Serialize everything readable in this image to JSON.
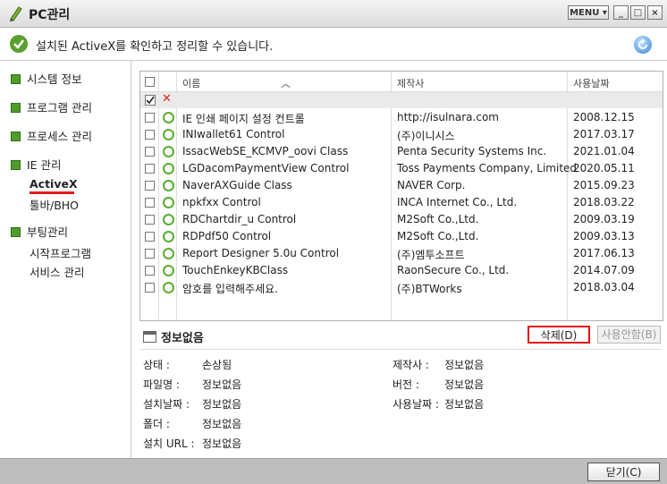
{
  "window": {
    "title": "PC관리",
    "menu_label": "MENU",
    "minimize": "_",
    "maximize": "□",
    "close": "×"
  },
  "info_message": "설치된 ActiveX를 확인하고 정리할 수 있습니다.",
  "sidebar": {
    "system_info": "시스템 정보",
    "program_mgmt": "프로그램 관리",
    "process_mgmt": "프로세스 관리",
    "ie_mgmt": "IE 관리",
    "activex": "ActiveX",
    "toolbar_bho": "툴바/BHO",
    "boot_mgmt": "부팅관리",
    "startup_programs": "시작프로그램",
    "service_mgmt": "서비스 관리"
  },
  "table": {
    "columns": [
      "이름",
      "제작사",
      "사용날짜"
    ],
    "rows": [
      [
        "IE 인쇄 페이지 설정 컨트롤",
        "http://isulnara.com",
        "2008.12.15"
      ],
      [
        "INIwallet61 Control",
        "(주)이니시스",
        "2017.03.17"
      ],
      [
        "IssacWebSE_KCMVP_oovi Class",
        "Penta Security Systems Inc.",
        "2021.01.04"
      ],
      [
        "LGDacomPaymentView Control",
        "Toss Payments Company, Limited",
        "2020.05.11"
      ],
      [
        "NaverAXGuide Class",
        "NAVER Corp.",
        "2015.09.23"
      ],
      [
        "npkfxx Control",
        "INCA Internet Co., Ltd.",
        "2018.03.22"
      ],
      [
        "RDChartdir_u Control",
        "M2Soft Co.,Ltd.",
        "2009.03.19"
      ],
      [
        "RDPdf50 Control",
        "M2Soft Co.,Ltd.",
        "2009.03.13"
      ],
      [
        "Report Designer 5.0u Control",
        "(주)엠투소프트",
        "2017.06.13"
      ],
      [
        "TouchEnkeyKBClass",
        "RaonSecure Co., Ltd.",
        "2014.07.09"
      ],
      [
        "암호를 입력해주세요.",
        "(주)BTWorks",
        "2018.03.04"
      ]
    ]
  },
  "detail": {
    "title": "정보없음",
    "delete_button": "삭제(D)",
    "disable_button": "사용안함(B)",
    "status_label": "상태 :",
    "status_value": "손상됨",
    "maker_label": "제작사 :",
    "maker_value": "정보없음",
    "filename_label": "파일명 :",
    "filename_value": "정보없음",
    "version_label": "버전 :",
    "version_value": "정보없음",
    "install_date_label": "설치날짜 :",
    "install_date_value": "정보없음",
    "use_date_label": "사용날짜 :",
    "use_date_value": "정보없음",
    "folder_label": "폴더 :",
    "folder_value": "정보없음",
    "install_url_label": "설치 URL :",
    "install_url_value": "정보없음"
  },
  "footer": {
    "close_button": "닫기(C)"
  },
  "colors": {
    "accent_green": "#5aa02c",
    "highlight_red": "#e01010"
  }
}
